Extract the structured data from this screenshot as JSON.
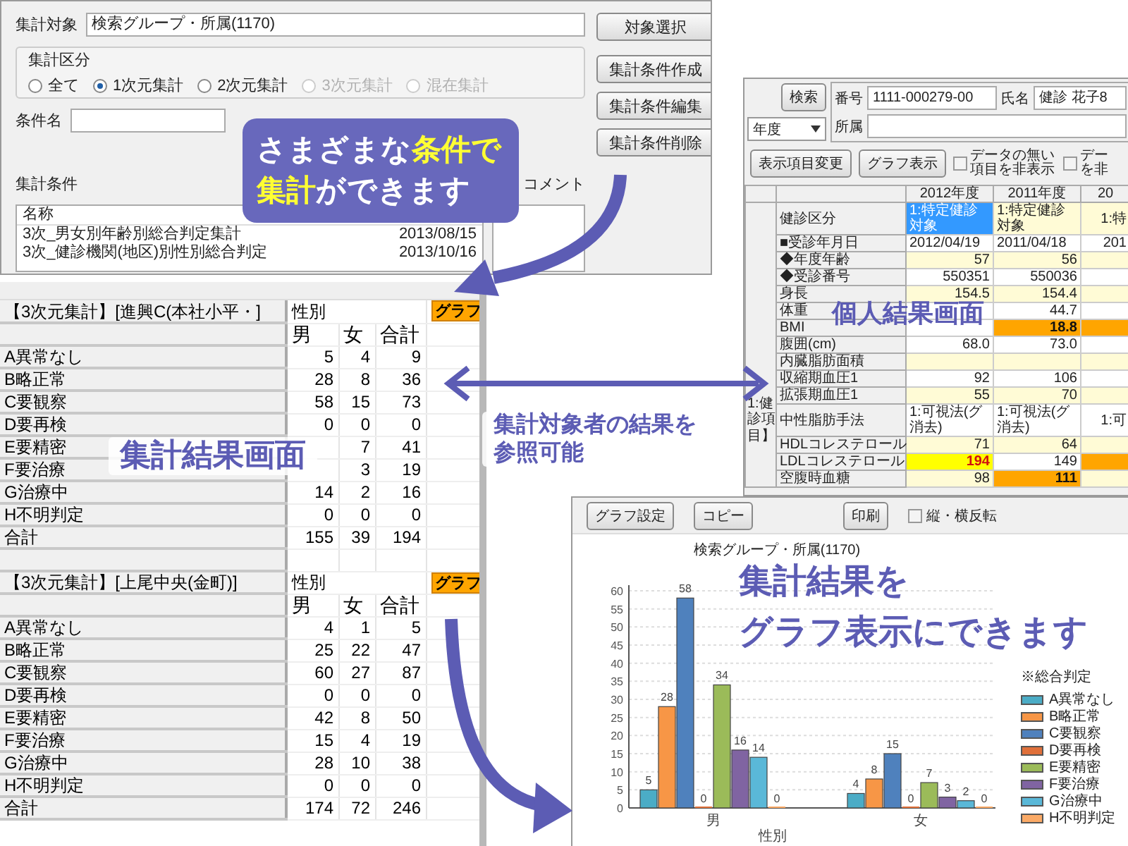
{
  "conditions_window": {
    "target_label": "集計対象",
    "target_value": "検索グループ・所属(1170)",
    "select_button": "対象選択",
    "actions": [
      "集計条件作成",
      "集計条件編集",
      "集計条件削除"
    ],
    "mode_group": {
      "label": "集計区分",
      "options": [
        {
          "label": "全て",
          "selected": false,
          "disabled": false
        },
        {
          "label": "1次元集計",
          "selected": true,
          "disabled": false
        },
        {
          "label": "2次元集計",
          "selected": false,
          "disabled": false
        },
        {
          "label": "3次元集計",
          "selected": false,
          "disabled": true
        },
        {
          "label": "混在集計",
          "selected": false,
          "disabled": true
        }
      ]
    },
    "name_label": "条件名",
    "list_label": "集計条件",
    "comment_label": "コメント",
    "list_header": "名称",
    "rows": [
      {
        "name": "3次_男女別年齢別総合判定集計",
        "date": "2013/08/15"
      },
      {
        "name": "3次_健診機関(地区)別性別総合判定",
        "date": "2013/10/16"
      }
    ]
  },
  "personal_window": {
    "search_button": "検索",
    "year_select": "年度",
    "id_label": "番号",
    "id_value": "1111-000279-00",
    "name_label": "氏名",
    "name_value": "健診 花子8",
    "dept_label": "所属",
    "buttons": [
      "表示項目変更",
      "グラフ表示"
    ],
    "checkboxes": [
      {
        "label": "データの無い項目を非表示",
        "checked": false
      },
      {
        "label": "デーを非",
        "checked": false
      }
    ],
    "group_label": "1:健診項目】",
    "columns": [
      "2012年度",
      "2011年度",
      "20"
    ],
    "rows": [
      {
        "label": "健診区分",
        "cells": [
          {
            "text": "1:特定健診対象",
            "color": "#3399ff"
          },
          {
            "text": "1:特定健診対象",
            "color": "#fffbd6"
          },
          {
            "text": "1:特",
            "color": "#fffbd6"
          }
        ]
      },
      {
        "label": "■受診年月日",
        "cells": [
          {
            "text": "2012/04/19"
          },
          {
            "text": "2011/04/18"
          },
          {
            "text": "201"
          }
        ]
      },
      {
        "label": "◆年度年齢",
        "cells": [
          {
            "text": "57",
            "color": "#fffbd6"
          },
          {
            "text": "56",
            "color": "#fffbd6"
          },
          {
            "color": "#fffbd6"
          }
        ]
      },
      {
        "label": "◆受診番号",
        "cells": [
          {
            "text": "550351"
          },
          {
            "text": "550036"
          },
          {}
        ]
      },
      {
        "label": "身長",
        "cells": [
          {
            "text": "154.5",
            "color": "#fffbd6"
          },
          {
            "text": "154.4",
            "color": "#fffbd6"
          },
          {
            "color": "#fffbd6"
          }
        ]
      },
      {
        "label": "体重",
        "cells": [
          {},
          {
            "text": "44.7"
          },
          {}
        ]
      },
      {
        "label": "BMI",
        "cells": [
          {},
          {
            "text": "18.8",
            "color": "#ffa500"
          },
          {
            "color": "#ffa500"
          }
        ]
      },
      {
        "label": "腹囲(cm)",
        "cells": [
          {
            "text": "68.0"
          },
          {
            "text": "73.0"
          },
          {}
        ]
      },
      {
        "label": "内臓脂肪面積",
        "cells": [
          {
            "color": "#fffbd6"
          },
          {
            "color": "#fffbd6"
          },
          {
            "color": "#fffbd6"
          }
        ]
      },
      {
        "label": "収縮期血圧1",
        "cells": [
          {
            "text": "92"
          },
          {
            "text": "106"
          },
          {}
        ]
      },
      {
        "label": "拡張期血圧1",
        "cells": [
          {
            "text": "55",
            "color": "#fffbd6"
          },
          {
            "text": "70",
            "color": "#fffbd6"
          },
          {
            "color": "#fffbd6"
          }
        ]
      },
      {
        "label": "中性脂肪手法",
        "cells": [
          {
            "text": "1:可視法(グ消去)"
          },
          {
            "text": "1:可視法(グ消去)"
          },
          {
            "text": "1:可"
          }
        ]
      },
      {
        "label": "HDLコレステロール",
        "cells": [
          {
            "text": "71",
            "color": "#fffbd6"
          },
          {
            "text": "64",
            "color": "#fffbd6"
          },
          {
            "color": "#fffbd6"
          }
        ]
      },
      {
        "label": "LDLコレステロール",
        "cells": [
          {
            "text": "194",
            "color": "#ffff00"
          },
          {
            "text": "149"
          },
          {
            "color": "#ffa500"
          }
        ]
      },
      {
        "label": "空腹時血糖",
        "cells": [
          {
            "text": "98",
            "color": "#fffbd6"
          },
          {
            "text": "111",
            "color": "#ffa500"
          },
          {
            "color": "#fffbd6"
          }
        ]
      }
    ]
  },
  "aggregate_table": {
    "blocks": [
      {
        "title": "【3次元集計】[進興C(本社小平・]",
        "axis": "性別",
        "graph_button": "グラフ",
        "columns": [
          "男",
          "女",
          "合計"
        ],
        "rows": [
          {
            "label": "A異常なし",
            "male": "5",
            "female": "4",
            "total": "9"
          },
          {
            "label": "B略正常",
            "male": "28",
            "female": "8",
            "total": "36"
          },
          {
            "label": "C要観察",
            "male": "58",
            "female": "15",
            "total": "73"
          },
          {
            "label": "D要再検",
            "male": "0",
            "female": "0",
            "total": "0"
          },
          {
            "label": "E要精密",
            "female": "7",
            "total": "41"
          },
          {
            "label": "F要治療",
            "female": "3",
            "total": "19"
          },
          {
            "label": "G治療中",
            "male": "14",
            "female": "2",
            "total": "16"
          },
          {
            "label": "H不明判定",
            "male": "0",
            "female": "0",
            "total": "0"
          },
          {
            "label": "合計",
            "male": "155",
            "female": "39",
            "total": "194"
          }
        ]
      },
      {
        "title": "【3次元集計】[上尾中央(金町)]",
        "axis": "性別",
        "graph_button": "グラフ",
        "columns": [
          "男",
          "女",
          "合計"
        ],
        "rows": [
          {
            "label": "A異常なし",
            "male": "4",
            "female": "1",
            "total": "5"
          },
          {
            "label": "B略正常",
            "male": "25",
            "female": "22",
            "total": "47"
          },
          {
            "label": "C要観察",
            "male": "60",
            "female": "27",
            "total": "87"
          },
          {
            "label": "D要再検",
            "male": "0",
            "female": "0",
            "total": "0"
          },
          {
            "label": "E要精密",
            "male": "42",
            "female": "8",
            "total": "50"
          },
          {
            "label": "F要治療",
            "male": "15",
            "female": "4",
            "total": "19"
          },
          {
            "label": "G治療中",
            "male": "28",
            "female": "10",
            "total": "38"
          },
          {
            "label": "H不明判定",
            "male": "0",
            "female": "0",
            "total": "0"
          },
          {
            "label": "合計",
            "male": "174",
            "female": "72",
            "total": "246"
          }
        ]
      }
    ]
  },
  "graph_window": {
    "buttons": [
      "グラフ設定",
      "コピー",
      "印刷"
    ],
    "checkbox": {
      "label": "縦・横反転",
      "checked": false
    },
    "legend_title": "※総合判定",
    "chart_data": {
      "type": "bar",
      "title": "検索グループ・所属(1170)",
      "xlabel": "性別",
      "categories": [
        "男",
        "女"
      ],
      "data_labels": true,
      "grid": true,
      "ylim": [
        0,
        60
      ],
      "yticks": [
        0,
        5,
        10,
        15,
        20,
        25,
        30,
        35,
        40,
        45,
        50,
        55,
        60
      ],
      "series": [
        {
          "name": "A異常なし",
          "color": "#4bacc6",
          "values": [
            5,
            4
          ]
        },
        {
          "name": "B略正常",
          "color": "#f79646",
          "values": [
            28,
            8
          ]
        },
        {
          "name": "C要観察",
          "color": "#4f81bd",
          "values": [
            58,
            15
          ]
        },
        {
          "name": "D要再検",
          "color": "#e0703a",
          "values": [
            0,
            0
          ]
        },
        {
          "name": "E要精密",
          "color": "#9bbb59",
          "values": [
            34,
            7
          ]
        },
        {
          "name": "F要治療",
          "color": "#8064a2",
          "values": [
            16,
            3
          ]
        },
        {
          "name": "G治療中",
          "color": "#5ab8d8",
          "values": [
            14,
            2
          ]
        },
        {
          "name": "H不明判定",
          "color": "#fbaa66",
          "values": [
            0,
            0
          ]
        }
      ]
    }
  },
  "callout": {
    "lines": [
      "さまざまな**条件で**",
      "**集計**ができます"
    ]
  },
  "labels": {
    "personal": "個人結果画面",
    "aggregate": "集計結果画面",
    "link": "集計対象者の結果を参照可能",
    "graph": [
      "集計結果を",
      "グラフ表示にできます"
    ]
  }
}
